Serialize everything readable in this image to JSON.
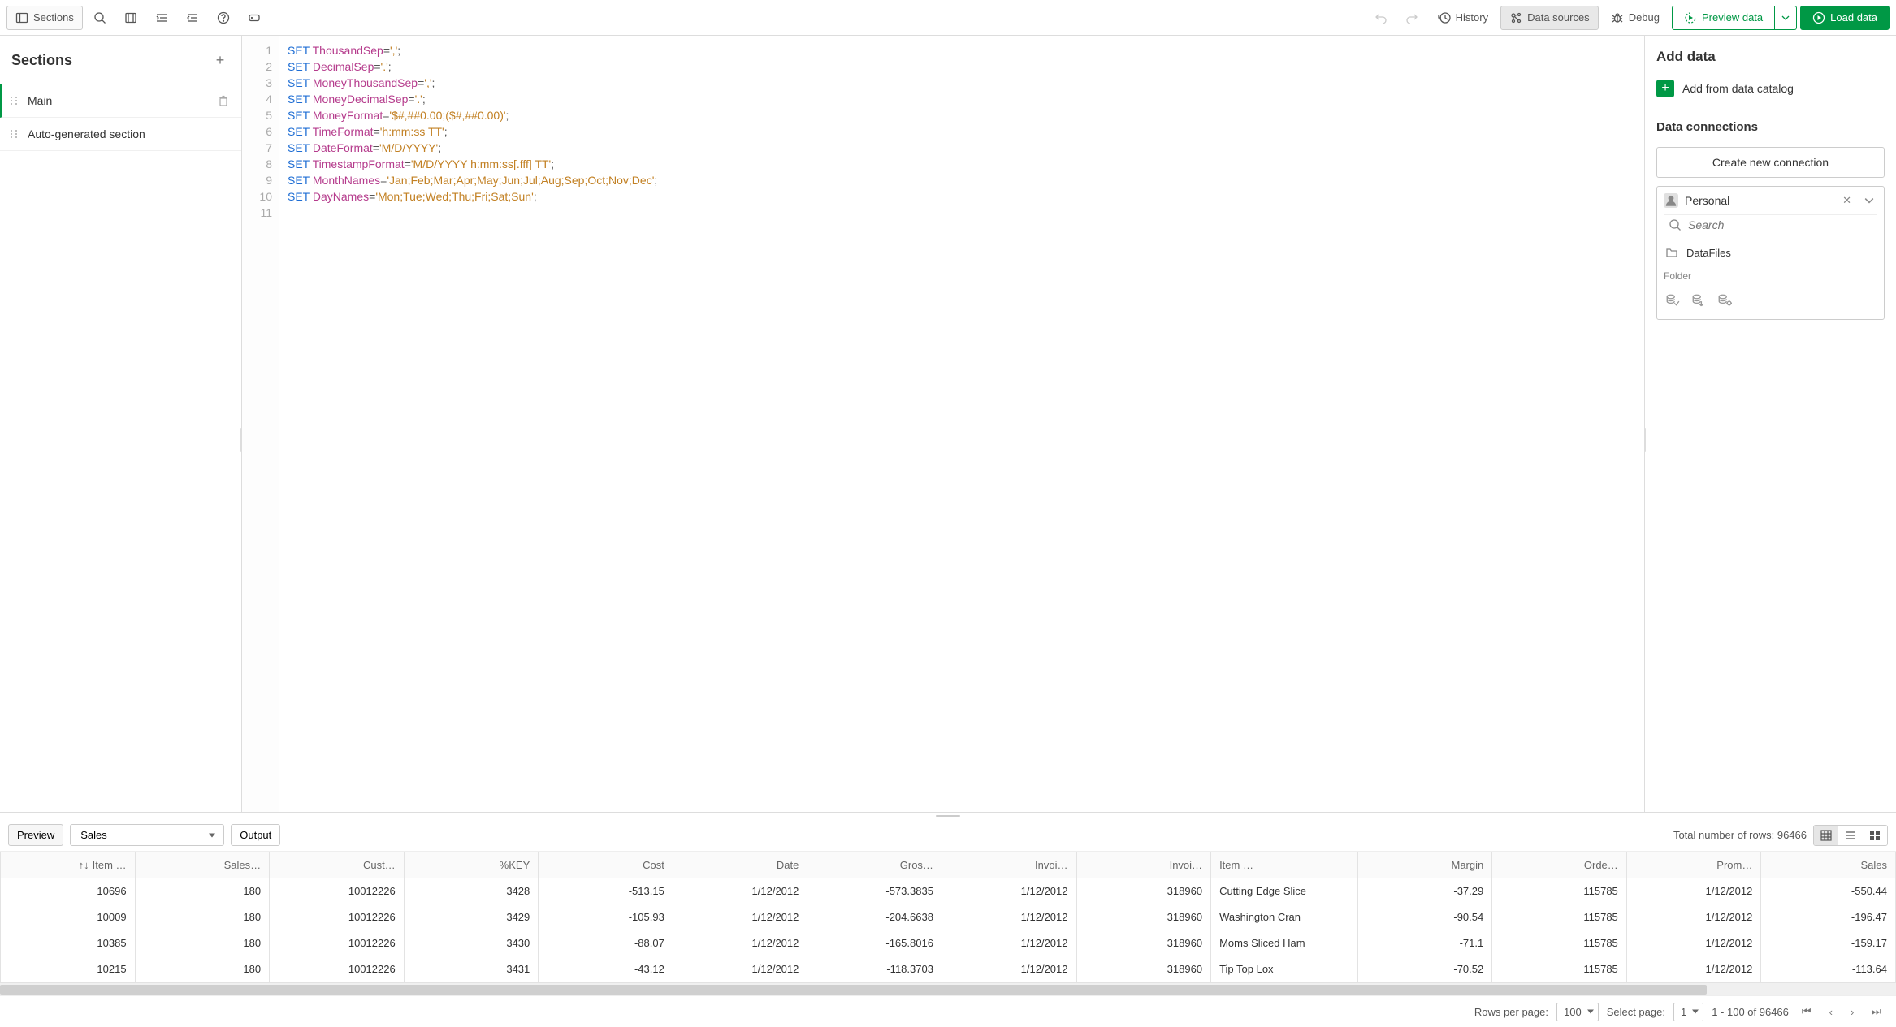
{
  "toolbar": {
    "sections_label": "Sections",
    "history_label": "History",
    "data_sources_label": "Data sources",
    "debug_label": "Debug",
    "preview_data_label": "Preview data",
    "load_data_label": "Load data"
  },
  "sections_panel": {
    "title": "Sections",
    "items": [
      {
        "label": "Main",
        "selected": true
      },
      {
        "label": "Auto-generated section",
        "selected": false
      }
    ]
  },
  "editor": {
    "lines": [
      {
        "n": "1",
        "kw": "SET",
        "var": "ThousandSep",
        "val": "','"
      },
      {
        "n": "2",
        "kw": "SET",
        "var": "DecimalSep",
        "val": "'.'"
      },
      {
        "n": "3",
        "kw": "SET",
        "var": "MoneyThousandSep",
        "val": "','"
      },
      {
        "n": "4",
        "kw": "SET",
        "var": "MoneyDecimalSep",
        "val": "'.'"
      },
      {
        "n": "5",
        "kw": "SET",
        "var": "MoneyFormat",
        "val": "'$#,##0.00;($#,##0.00)'"
      },
      {
        "n": "6",
        "kw": "SET",
        "var": "TimeFormat",
        "val": "'h:mm:ss TT'"
      },
      {
        "n": "7",
        "kw": "SET",
        "var": "DateFormat",
        "val": "'M/D/YYYY'"
      },
      {
        "n": "8",
        "kw": "SET",
        "var": "TimestampFormat",
        "val": "'M/D/YYYY h:mm:ss[.fff] TT'"
      },
      {
        "n": "9",
        "kw": "SET",
        "var": "MonthNames",
        "val": "'Jan;Feb;Mar;Apr;May;Jun;Jul;Aug;Sep;Oct;Nov;Dec'"
      },
      {
        "n": "10",
        "kw": "SET",
        "var": "DayNames",
        "val": "'Mon;Tue;Wed;Thu;Fri;Sat;Sun'"
      },
      {
        "n": "11",
        "kw": "",
        "var": "",
        "val": ""
      }
    ]
  },
  "data_panel": {
    "add_data_title": "Add data",
    "add_from_catalog": "Add from data catalog",
    "connections_title": "Data connections",
    "create_new_connection": "Create new connection",
    "space_name": "Personal",
    "search_placeholder": "Search",
    "datafiles_label": "DataFiles",
    "folder_label": "Folder"
  },
  "preview_bar": {
    "preview_tab": "Preview",
    "source_selected": "Sales",
    "output_tab": "Output",
    "total_rows_label": "Total number of rows: 96466"
  },
  "grid": {
    "headers": [
      "Item …",
      "Sales…",
      "Cust…",
      "%KEY",
      "Cost",
      "Date",
      "Gros…",
      "Invoi…",
      "Invoi…",
      "Item …",
      "Margin",
      "Orde…",
      "Prom…",
      "Sales"
    ],
    "rows": [
      [
        "10696",
        "180",
        "10012226",
        "3428",
        "-513.15",
        "1/12/2012",
        "-573.3835",
        "1/12/2012",
        "318960",
        "Cutting Edge Slice",
        "-37.29",
        "115785",
        "1/12/2012",
        "-550.44"
      ],
      [
        "10009",
        "180",
        "10012226",
        "3429",
        "-105.93",
        "1/12/2012",
        "-204.6638",
        "1/12/2012",
        "318960",
        "Washington Cran",
        "-90.54",
        "115785",
        "1/12/2012",
        "-196.47"
      ],
      [
        "10385",
        "180",
        "10012226",
        "3430",
        "-88.07",
        "1/12/2012",
        "-165.8016",
        "1/12/2012",
        "318960",
        "Moms Sliced Ham",
        "-71.1",
        "115785",
        "1/12/2012",
        "-159.17"
      ],
      [
        "10215",
        "180",
        "10012226",
        "3431",
        "-43.12",
        "1/12/2012",
        "-118.3703",
        "1/12/2012",
        "318960",
        "Tip Top Lox",
        "-70.52",
        "115785",
        "1/12/2012",
        "-113.64"
      ]
    ]
  },
  "pager": {
    "rows_per_page_label": "Rows per page:",
    "rows_per_page_value": "100",
    "select_page_label": "Select page:",
    "select_page_value": "1",
    "range_label": "1 - 100 of 96466"
  }
}
